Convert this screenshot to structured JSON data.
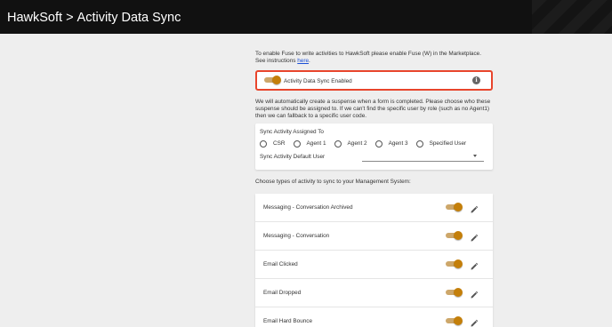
{
  "header": {
    "app": "HawkSoft",
    "separator": ">",
    "page": "Activity Data Sync"
  },
  "intro": {
    "text": "To enable Fuse to write activities to HawkSoft please enable Fuse (W) in the Marketplace. See instructions ",
    "link": "here",
    "suffix": "."
  },
  "sync_enabled": {
    "label": "Activity Data Sync Enabled",
    "enabled": true,
    "info_icon": "info-icon"
  },
  "suspense_text": "We will automatically create a suspense when a form is completed. Please choose who these suspense should be assigned to. If we can't find the specific user by role (such as no Agent1) then we can fallback to a specific user code.",
  "assign": {
    "title": "Sync Activity Assigned To",
    "options": [
      "CSR",
      "Agent 1",
      "Agent 2",
      "Agent 3",
      "Specified User"
    ],
    "default_user_label": "Sync Activity Default User",
    "default_user_value": ""
  },
  "types_label": "Choose types of activity to sync to your Management System:",
  "activities": [
    {
      "label": "Messaging - Conversation Archived",
      "enabled": true
    },
    {
      "label": "Messaging - Conversation",
      "enabled": true
    },
    {
      "label": "Email Clicked",
      "enabled": true
    },
    {
      "label": "Email Dropped",
      "enabled": true
    },
    {
      "label": "Email Hard Bounce",
      "enabled": true
    }
  ],
  "colors": {
    "accent": "#c47f0a",
    "highlight_border": "#e8452c",
    "header_bg": "#111111"
  }
}
